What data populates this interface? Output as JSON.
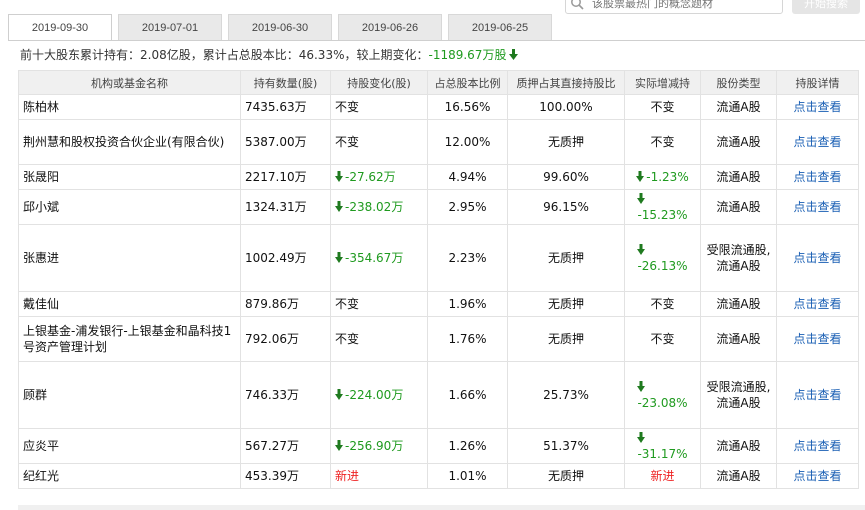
{
  "search": {
    "placeholder": "该股票最热门的概念题材",
    "button_label": "开始搜索"
  },
  "tabs": [
    "2019-09-30",
    "2019-07-01",
    "2019-06-30",
    "2019-06-26",
    "2019-06-25"
  ],
  "summary": {
    "prefix": "前十大股东累计持有：2.08亿股，累计占总股本比：46.33%，较上期变化：",
    "change": "-1189.67万股"
  },
  "columns": [
    "机构或基金名称",
    "持有数量(股)",
    "持股变化(股)",
    "占总股本比例",
    "质押占其直接持股比",
    "实际增减持",
    "股份类型",
    "持股详情"
  ],
  "rows": [
    {
      "name": "陈柏林",
      "qty": "7435.63万",
      "change": "不变",
      "change_dir": "none",
      "ratio": "16.56%",
      "pledge": "100.00%",
      "actual": "不变",
      "actual_dir": "none",
      "type": "流通A股",
      "detail": "点击查看"
    },
    {
      "name": "荆州慧和股权投资合伙企业(有限合伙)",
      "qty": "5387.00万",
      "change": "不变",
      "change_dir": "none",
      "ratio": "12.00%",
      "pledge": "无质押",
      "actual": "不变",
      "actual_dir": "none",
      "type": "流通A股",
      "detail": "点击查看"
    },
    {
      "name": "张晟阳",
      "qty": "2217.10万",
      "change": "-27.62万",
      "change_dir": "down",
      "ratio": "4.94%",
      "pledge": "99.60%",
      "actual": "-1.23%",
      "actual_dir": "down",
      "type": "流通A股",
      "detail": "点击查看"
    },
    {
      "name": "邱小斌",
      "qty": "1324.31万",
      "change": "-238.02万",
      "change_dir": "down",
      "ratio": "2.95%",
      "pledge": "96.15%",
      "actual": "-15.23%",
      "actual_dir": "down-stack",
      "type": "流通A股",
      "detail": "点击查看"
    },
    {
      "name": "张惠进",
      "qty": "1002.49万",
      "change": "-354.67万",
      "change_dir": "down",
      "ratio": "2.23%",
      "pledge": "无质押",
      "actual": "-26.13%",
      "actual_dir": "down-stack",
      "type": "受限流通股,流通A股",
      "detail": "点击查看"
    },
    {
      "name": "戴佳仙",
      "qty": "879.86万",
      "change": "不变",
      "change_dir": "none",
      "ratio": "1.96%",
      "pledge": "无质押",
      "actual": "不变",
      "actual_dir": "none",
      "type": "流通A股",
      "detail": "点击查看"
    },
    {
      "name": "上银基金-浦发银行-上银基金和晶科技1号资产管理计划",
      "qty": "792.06万",
      "change": "不变",
      "change_dir": "none",
      "ratio": "1.76%",
      "pledge": "无质押",
      "actual": "不变",
      "actual_dir": "none",
      "type": "流通A股",
      "detail": "点击查看"
    },
    {
      "name": "顾群",
      "qty": "746.33万",
      "change": "-224.00万",
      "change_dir": "down",
      "ratio": "1.66%",
      "pledge": "25.73%",
      "actual": "-23.08%",
      "actual_dir": "down-stack",
      "type": "受限流通股,流通A股",
      "detail": "点击查看"
    },
    {
      "name": "应炎平",
      "qty": "567.27万",
      "change": "-256.90万",
      "change_dir": "down",
      "ratio": "1.26%",
      "pledge": "51.37%",
      "actual": "-31.17%",
      "actual_dir": "down-stack",
      "type": "流通A股",
      "detail": "点击查看"
    },
    {
      "name": "纪红光",
      "qty": "453.39万",
      "change": "新进",
      "change_dir": "new",
      "ratio": "1.01%",
      "pledge": "无质押",
      "actual": "新进",
      "actual_dir": "new",
      "type": "流通A股",
      "detail": "点击查看"
    }
  ],
  "colors": {
    "down": "#1f9a1f",
    "new": "#e22222",
    "link": "#1a5fb4"
  }
}
